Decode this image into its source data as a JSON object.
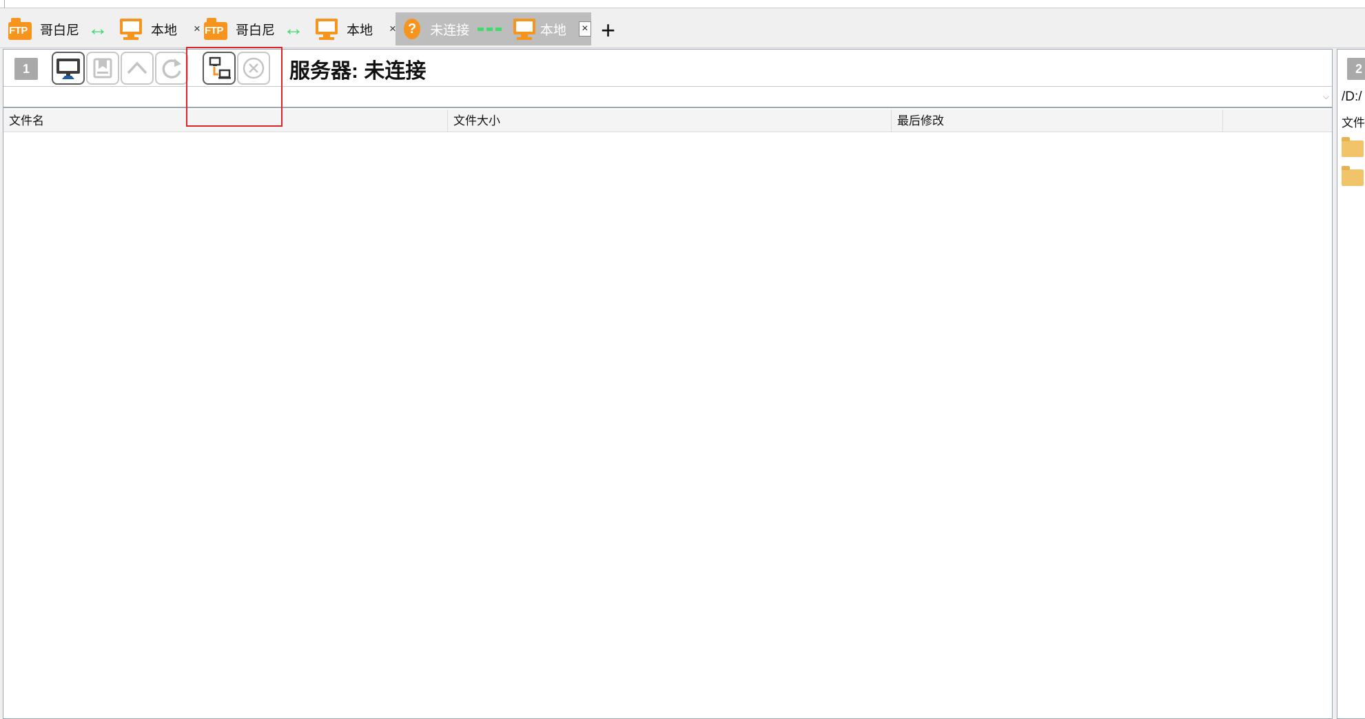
{
  "tabs": [
    {
      "ftp_label": "FTP",
      "remote": "哥白尼",
      "local": "本地",
      "close": "×",
      "state": "connected"
    },
    {
      "ftp_label": "FTP",
      "remote": "哥白尼",
      "local": "本地",
      "close": "×",
      "state": "connected"
    },
    {
      "status_glyph": "?",
      "remote": "未连接",
      "local": "本地",
      "close": "×",
      "state": "disconnected",
      "active": true
    }
  ],
  "new_tab_glyph": "+",
  "left_panel": {
    "number": "1",
    "toolbar_buttons": [
      {
        "name": "local-computer-icon",
        "enabled": true
      },
      {
        "name": "bookmark-icon",
        "enabled": false
      },
      {
        "name": "up-arrow-icon",
        "enabled": false
      },
      {
        "name": "refresh-icon",
        "enabled": false
      },
      {
        "name": "connect-server-icon",
        "enabled": true
      },
      {
        "name": "disconnect-icon",
        "enabled": false
      }
    ],
    "server_title": "服务器: 未连接",
    "path": "",
    "columns": [
      "文件名",
      "文件大小",
      "最后修改"
    ]
  },
  "right_panel": {
    "number": "2",
    "path": "/D:/",
    "column_header": "文件"
  },
  "colors": {
    "accent_orange": "#f7941d",
    "connected_green": "#3ddc6c",
    "highlight_red": "#e0222a"
  }
}
